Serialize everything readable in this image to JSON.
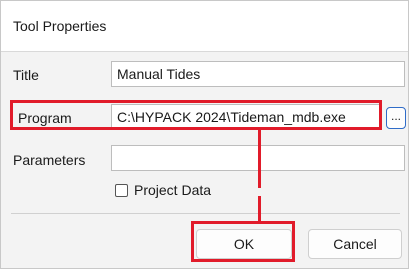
{
  "dialog": {
    "title": "Tool Properties",
    "fields": {
      "title_label": "Title",
      "title_value": "Manual Tides",
      "program_label": "Program",
      "program_value": "C:\\HYPACK 2024\\Tideman_mdb.exe",
      "parameters_label": "Parameters",
      "parameters_value": ""
    },
    "browse_label": "...",
    "project_data_label": "Project Data",
    "project_data_checked": false,
    "ok_label": "OK",
    "cancel_label": "Cancel"
  },
  "annotation": {
    "highlight_color": "#e11b2a"
  }
}
